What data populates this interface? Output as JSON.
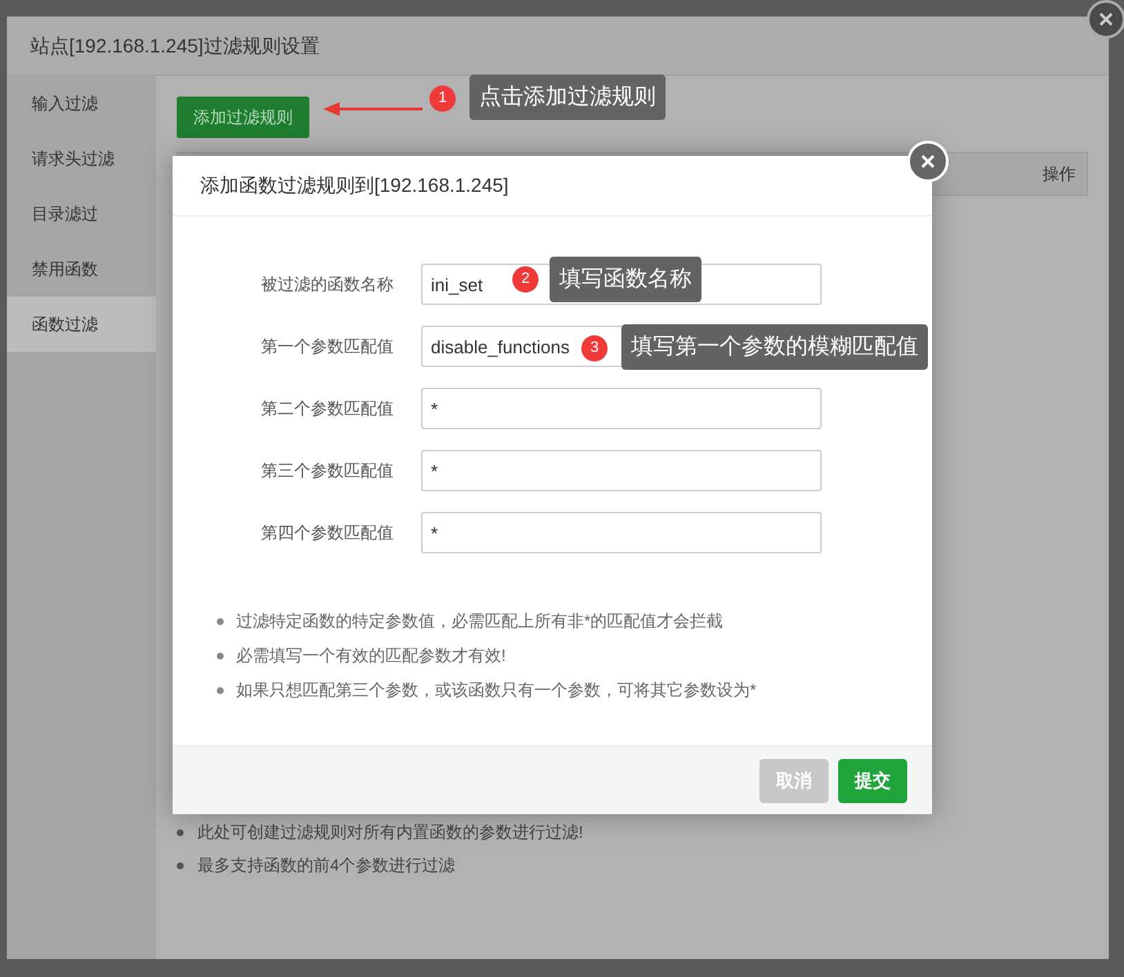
{
  "window": {
    "title": "站点[192.168.1.245]过滤规则设置"
  },
  "sidebar": {
    "items": [
      {
        "label": "输入过滤",
        "selected": false
      },
      {
        "label": "请求头过滤",
        "selected": false
      },
      {
        "label": "目录滤过",
        "selected": false
      },
      {
        "label": "禁用函数",
        "selected": false
      },
      {
        "label": "函数过滤",
        "selected": true
      }
    ]
  },
  "add_rule_button": "添加过滤规则",
  "table": {
    "columns": [
      {
        "label": "操作"
      }
    ]
  },
  "notes": [
    "此处可创建过滤规则对所有内置函数的参数进行过滤!",
    "最多支持函数的前4个参数进行过滤"
  ],
  "dialog": {
    "title": "添加函数过滤规则到[192.168.1.245]",
    "fields": [
      {
        "label": "被过滤的函数名称",
        "value": "ini_set"
      },
      {
        "label": "第一个参数匹配值",
        "value": "disable_functions"
      },
      {
        "label": "第二个参数匹配值",
        "value": "*"
      },
      {
        "label": "第三个参数匹配值",
        "value": "*"
      },
      {
        "label": "第四个参数匹配值",
        "value": "*"
      }
    ],
    "notes": [
      "过滤特定函数的特定参数值，必需匹配上所有非*的匹配值才会拦截",
      "必需填写一个有效的匹配参数才有效!",
      "如果只想匹配第三个参数，或该函数只有一个参数，可将其它参数设为*"
    ],
    "buttons": [
      {
        "label": "取消",
        "kind": "cancel"
      },
      {
        "label": "提交",
        "kind": "submit"
      }
    ]
  },
  "annotations": [
    {
      "number": "1",
      "text": "点击添加过滤规则"
    },
    {
      "number": "2",
      "text": "填写函数名称"
    },
    {
      "number": "3",
      "text": "填写第一个参数的模糊匹配值"
    }
  ]
}
